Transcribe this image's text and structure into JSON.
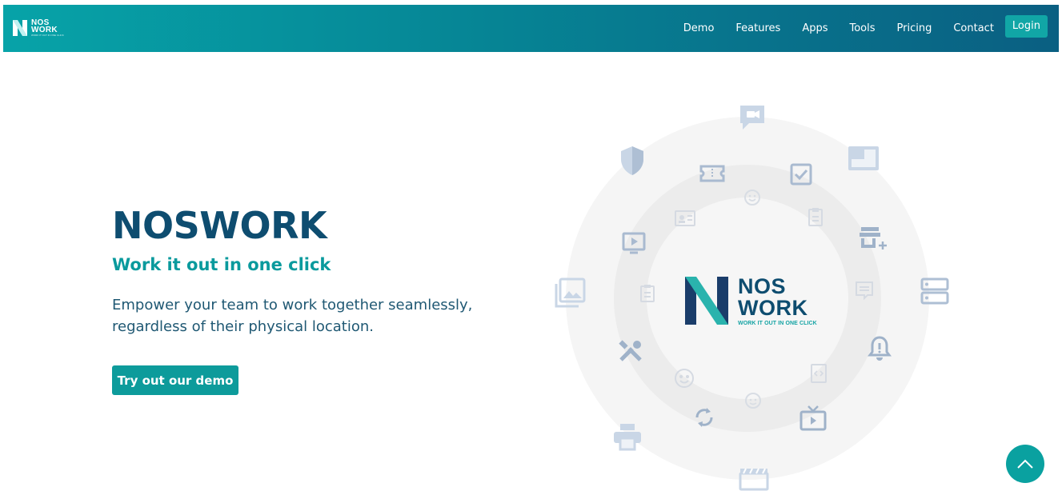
{
  "brand": {
    "line1": "NOS",
    "line2": "WORK",
    "tagline": "WORK IT OUT IN ONE CLICK"
  },
  "nav": {
    "items": [
      "Demo",
      "Features",
      "Apps",
      "Tools",
      "Pricing",
      "Contact"
    ],
    "login": "Login"
  },
  "hero": {
    "title": "NOSWORK",
    "subtitle": "Work it out in one click",
    "description": "Empower your team to work together seamlessly, regardless of their physical location.",
    "cta": "Try out our demo"
  },
  "center_logo": {
    "line1": "NOS",
    "line2": "WORK",
    "tagline": "WORK IT OUT IN ONE CLICK"
  },
  "colors": {
    "navy": "#0e4d70",
    "teal": "#0d9b9b",
    "icon_blue": "#9fb8d6",
    "icon_grey": "#cfd5dd"
  },
  "orbit_icons": [
    "video-chat-icon",
    "shield-icon",
    "image-window-icon",
    "ticket-icon",
    "checkbox-icon",
    "smile-icon",
    "contact-card-icon",
    "clipboard-icon",
    "store-add-icon",
    "video-player-icon",
    "gallery-icon",
    "document-icon",
    "notes-icon",
    "server-icon",
    "tools-icon",
    "bell-icon",
    "emoji-icon",
    "code-file-icon",
    "smile-small-icon",
    "sync-icon",
    "tv-play-icon",
    "printer-icon",
    "clapperboard-icon"
  ]
}
